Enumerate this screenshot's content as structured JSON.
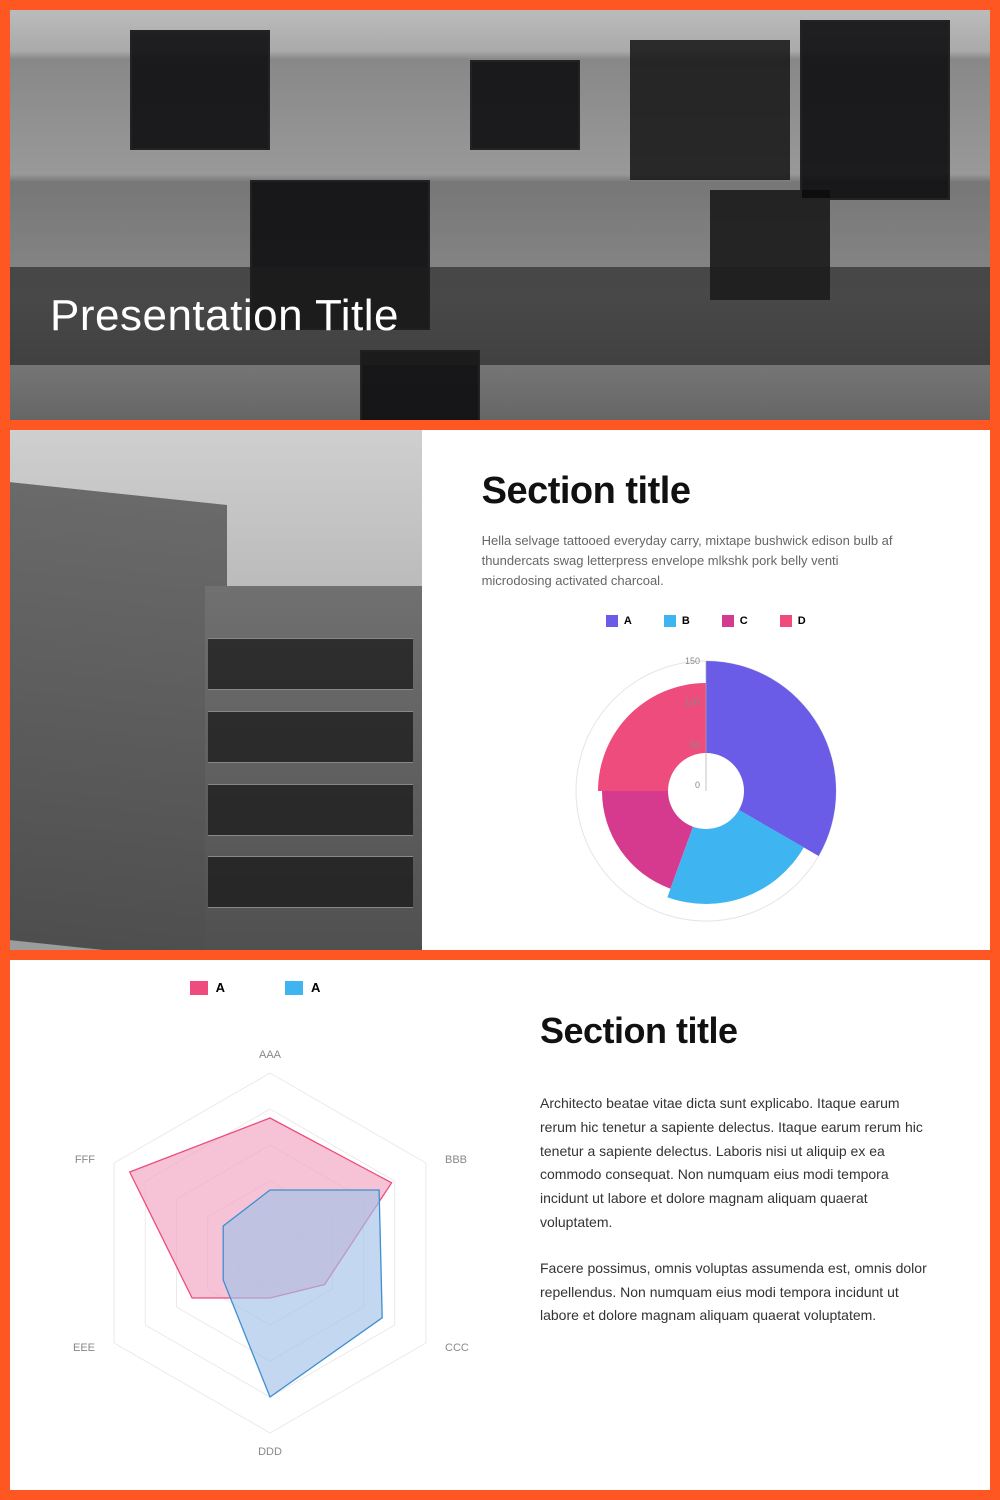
{
  "colors": {
    "accent": "#ff5722",
    "purple": "#6b5ce7",
    "blue": "#3eb5f1",
    "magenta": "#d63a8f",
    "pink": "#ee4c7c",
    "pinkSoft": "#f0a3be",
    "blueSoft": "#a3c1e8"
  },
  "slide1": {
    "title": "Presentation Title"
  },
  "slide2": {
    "heading": "Section title",
    "body": "Hella selvage tattooed everyday carry, mixtape bushwick edison bulb af thundercats swag letterpress envelope mlkshk pork belly venti microdosing activated charcoal.",
    "legend": [
      {
        "label": "A",
        "color": "#6b5ce7"
      },
      {
        "label": "B",
        "color": "#3eb5f1"
      },
      {
        "label": "C",
        "color": "#d63a8f"
      },
      {
        "label": "D",
        "color": "#ee4c7c"
      }
    ],
    "axis_ticks": [
      "0",
      "50",
      "100",
      "150"
    ]
  },
  "slide3": {
    "heading": "Section title",
    "para1": "Architecto beatae vitae dicta sunt explicabo. Itaque earum rerum hic tenetur a sapiente delectus. Itaque earum rerum hic tenetur a sapiente delectus. Laboris nisi ut aliquip ex ea commodo consequat. Non numquam eius modi tempora incidunt ut labore et dolore magnam aliquam quaerat voluptatem.",
    "para2": "Facere possimus, omnis voluptas assumenda est, omnis dolor repellendus. Non numquam eius modi tempora incidunt ut labore et dolore magnam aliquam quaerat voluptatem.",
    "legend": [
      {
        "label": "A",
        "color": "#ee4c7c"
      },
      {
        "label": "A",
        "color": "#3eb5f1"
      }
    ],
    "axes": [
      "AAA",
      "BBB",
      "CCC",
      "DDD",
      "EEE",
      "FFF"
    ]
  },
  "chart_data": [
    {
      "type": "pie",
      "title": "",
      "radial_scale": {
        "ticks": [
          0,
          50,
          100,
          150
        ],
        "max": 150
      },
      "categories": [
        "A",
        "B",
        "C",
        "D"
      ],
      "series": [
        {
          "name": "A",
          "color": "#6b5ce7",
          "value": 150,
          "angle_span_deg": 120
        },
        {
          "name": "B",
          "color": "#3eb5f1",
          "value": 130,
          "angle_span_deg": 80
        },
        {
          "name": "C",
          "color": "#d63a8f",
          "value": 120,
          "angle_span_deg": 70
        },
        {
          "name": "D",
          "color": "#ee4c7c",
          "value": 125,
          "angle_span_deg": 90
        }
      ]
    },
    {
      "type": "radar",
      "title": "",
      "axes": [
        "AAA",
        "BBB",
        "CCC",
        "DDD",
        "EEE",
        "FFF"
      ],
      "range": [
        0,
        100
      ],
      "series": [
        {
          "name": "A",
          "color": "#ee4c7c",
          "values": [
            75,
            78,
            35,
            25,
            50,
            90
          ]
        },
        {
          "name": "A",
          "color": "#3eb5f1",
          "values": [
            35,
            70,
            72,
            80,
            30,
            30
          ]
        }
      ]
    }
  ]
}
